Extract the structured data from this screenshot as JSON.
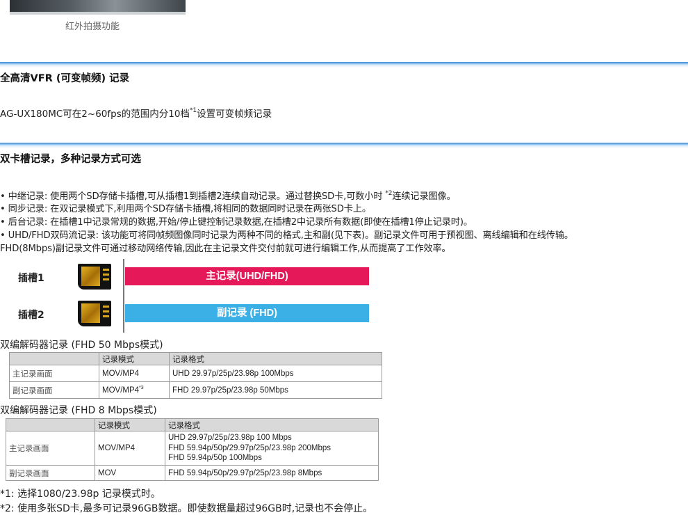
{
  "top_image": {
    "caption": "红外拍摄功能"
  },
  "section_vfr": {
    "title": "全高清VFR (可变帧频) 记录",
    "text_before": "AG-UX180MC可在2~60fps的范围内分10档",
    "sup": "*1",
    "text_after": "设置可变帧频记录"
  },
  "section_dual": {
    "title": "双卡槽记录，多种记录方式可选",
    "bullet1_before": "• 中继记录: 使用两个SD存储卡插槽,可从插槽1到插槽2连续自动记录。通过替换SD卡,可数小时 ",
    "bullet1_sup": "*2",
    "bullet1_after": "连续记录图像。",
    "bullet2": "• 同步记录: 在双记录模式下,利用两个SD存储卡插槽,将相同的数据同时记录在两张SD卡上。",
    "bullet3": "• 后台记录: 在插槽1中记录常规的数据,开始/停止键控制记录数据,在插槽2中记录所有数据(即使在插槽1停止记录时)。",
    "bullet4": "• UHD/FHD双码流记录: 该功能可将同帧频图像同时记录为两种不同的格式,主和副(见下表)。副记录文件可用于预视图、离线编辑和在线传输。",
    "bullet5": "FHD(8Mbps)副记录文件可通过移动网络传输,因此在主记录文件交付前就可进行编辑工作,从而提高了工作效率。"
  },
  "diagram": {
    "slot1_label": "插槽1",
    "slot2_label": "插槽2",
    "main_bar": "主记录(UHD/FHD)",
    "sub_bar": "副记录 (FHD)",
    "main_color": "#e5185a",
    "sub_color": "#3ab0e6"
  },
  "table1": {
    "caption": "双编解码器记录 (FHD 50 Mbps模式)",
    "headers": [
      "",
      "记录模式",
      "记录格式"
    ],
    "rows": [
      {
        "label": "主记录画面",
        "mode": "MOV/MP4",
        "mode_sup": "",
        "format": [
          "UHD 29.97p/25p/23.98p 100Mbps"
        ]
      },
      {
        "label": "副记录画面",
        "mode": "MOV/MP4",
        "mode_sup": "*3",
        "format": [
          "FHD 29.97p/25p/23.98p 50Mbps"
        ]
      }
    ]
  },
  "table2": {
    "caption": "双编解码器记录 (FHD 8 Mbps模式)",
    "headers": [
      "",
      "记录模式",
      "记录格式"
    ],
    "rows": [
      {
        "label": "主记录画面",
        "mode": "MOV/MP4",
        "format": [
          "UHD 29.97p/25p/23.98p 100 Mbps",
          "FHD 59.94p/50p/29.97p/25p/23.98p 200Mbps",
          "FHD 59.94p/50p 100Mbps"
        ]
      },
      {
        "label": "副记录画面",
        "mode": "MOV",
        "format": [
          "FHD 59.94p/50p/29.97p/25p/23.98p 8Mbps"
        ]
      }
    ]
  },
  "footnotes": {
    "note1": "*1: 选择1080/23.98p 记录模式时。",
    "note2": "*2: 使用多张SD卡,最多可记录96GB数据。即使数据量超过96GB时,记录也不会停止。"
  }
}
